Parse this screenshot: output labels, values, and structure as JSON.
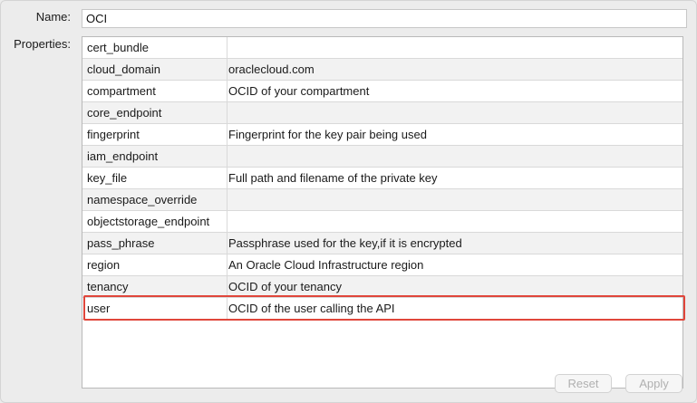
{
  "form": {
    "name_label": "Name:",
    "name_value": "OCI",
    "properties_label": "Properties:"
  },
  "properties": [
    {
      "key": "cert_bundle",
      "value": ""
    },
    {
      "key": "cloud_domain",
      "value": "oraclecloud.com"
    },
    {
      "key": "compartment",
      "value": "OCID of your compartment"
    },
    {
      "key": "core_endpoint",
      "value": ""
    },
    {
      "key": "fingerprint",
      "value": "Fingerprint for the key pair being used"
    },
    {
      "key": "iam_endpoint",
      "value": ""
    },
    {
      "key": "key_file",
      "value": "Full path and filename of the private key"
    },
    {
      "key": "namespace_override",
      "value": ""
    },
    {
      "key": "objectstorage_endpoint",
      "value": ""
    },
    {
      "key": "pass_phrase",
      "value": "Passphrase used for the key,if it is encrypted"
    },
    {
      "key": "region",
      "value": "An Oracle Cloud Infrastructure region"
    },
    {
      "key": "tenancy",
      "value": "OCID of your tenancy"
    },
    {
      "key": "user",
      "value": "OCID of the user calling the API"
    }
  ],
  "buttons": {
    "reset_label": "Reset",
    "apply_label": "Apply"
  },
  "colors": {
    "highlight": "#e0463b",
    "row_alt": "#f2f2f2",
    "disabled_text": "#b0b0b0"
  }
}
